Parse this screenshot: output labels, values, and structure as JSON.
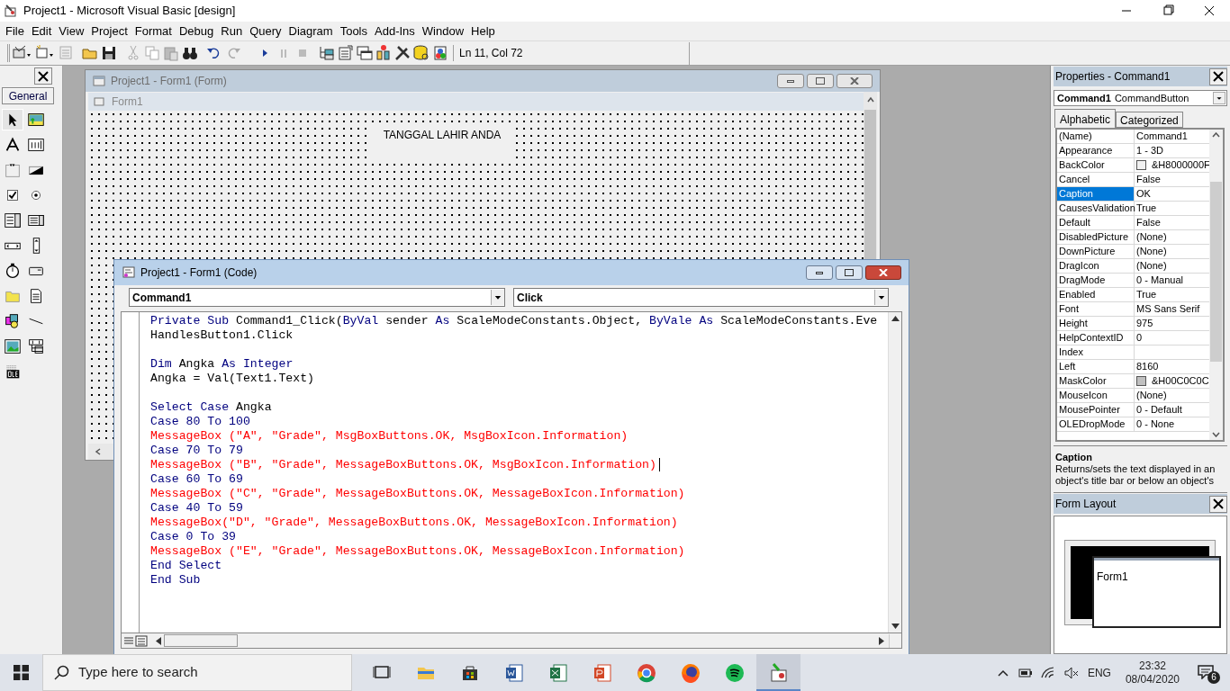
{
  "window": {
    "title": "Project1 - Microsoft Visual Basic [design]"
  },
  "menu": [
    "File",
    "Edit",
    "View",
    "Project",
    "Format",
    "Debug",
    "Run",
    "Query",
    "Diagram",
    "Tools",
    "Add-Ins",
    "Window",
    "Help"
  ],
  "toolbar": {
    "position": "Ln 11, Col 72"
  },
  "toolbox": {
    "tab": "General",
    "tools": [
      {
        "selected": true
      },
      {
        "selected": false
      },
      {
        "selected": false
      },
      {
        "selected": false
      },
      {
        "selected": false
      },
      {
        "selected": false
      },
      {
        "selected": false
      },
      {
        "selected": false
      },
      {
        "selected": false
      },
      {
        "selected": false
      },
      {
        "selected": false
      },
      {
        "selected": false
      },
      {
        "selected": false
      },
      {
        "selected": false
      },
      {
        "selected": false
      },
      {
        "selected": false
      },
      {
        "selected": false
      },
      {
        "selected": false
      },
      {
        "selected": false
      },
      {
        "selected": false
      },
      {
        "selected": false
      }
    ]
  },
  "form_window": {
    "title": "Project1 - Form1 (Form)",
    "form_caption": "Form1",
    "label": "TANGGAL LAHIR ANDA"
  },
  "code_window": {
    "title": "Project1 - Form1 (Code)",
    "object": "Command1",
    "procedure": "Click",
    "lines": [
      {
        "kind": "code",
        "segments": [
          {
            "kind": "keyword",
            "text": "Private Sub"
          },
          {
            "kind": "text",
            "text": " Command1_Click("
          },
          {
            "kind": "keyword",
            "text": "ByVal"
          },
          {
            "kind": "text",
            "text": " sender "
          },
          {
            "kind": "keyword",
            "text": "As"
          },
          {
            "kind": "text",
            "text": " ScaleModeConstants.Object, "
          },
          {
            "kind": "keyword",
            "text": "ByVale As"
          },
          {
            "kind": "text",
            "text": " ScaleModeConstants.Eve"
          }
        ]
      },
      {
        "kind": "code",
        "segments": [
          {
            "kind": "text",
            "text": "HandlesButton1.Click"
          }
        ]
      },
      {
        "kind": "blank"
      },
      {
        "kind": "code",
        "segments": [
          {
            "kind": "keyword",
            "text": "Dim"
          },
          {
            "kind": "text",
            "text": " Angka "
          },
          {
            "kind": "keyword",
            "text": "As Integer"
          }
        ]
      },
      {
        "kind": "code",
        "segments": [
          {
            "kind": "text",
            "text": "Angka = Val(Text1.Text)"
          }
        ]
      },
      {
        "kind": "blank"
      },
      {
        "kind": "code",
        "segments": [
          {
            "kind": "keyword",
            "text": "Select Case"
          },
          {
            "kind": "text",
            "text": " Angka"
          }
        ]
      },
      {
        "kind": "code",
        "segments": [
          {
            "kind": "keyword",
            "text": "Case 80 To 100"
          }
        ]
      },
      {
        "kind": "error",
        "text": "MessageBox (\"A\", \"Grade\", MsgBoxButtons.OK, MsgBoxIcon.Information)",
        "cursor": false
      },
      {
        "kind": "code",
        "segments": [
          {
            "kind": "keyword",
            "text": "Case 70 To 79"
          }
        ]
      },
      {
        "kind": "error",
        "text": "MessageBox (\"B\", \"Grade\", MessageBoxButtons.OK, MsgBoxIcon.Information)",
        "cursor": true
      },
      {
        "kind": "code",
        "segments": [
          {
            "kind": "keyword",
            "text": "Case 60 To 69"
          }
        ]
      },
      {
        "kind": "error",
        "text": "MessageBox (\"C\", \"Grade\", MessageBoxButtons.OK, MessageBoxIcon.Information)",
        "cursor": false
      },
      {
        "kind": "code",
        "segments": [
          {
            "kind": "keyword",
            "text": "Case 40 To 59"
          }
        ]
      },
      {
        "kind": "error",
        "text": "MessageBox(\"D\", \"Grade\", MessageBoxButtons.OK, MessageBoxIcon.Information)",
        "cursor": false
      },
      {
        "kind": "code",
        "segments": [
          {
            "kind": "keyword",
            "text": "Case 0 To 39"
          }
        ]
      },
      {
        "kind": "error",
        "text": "MessageBox (\"E\", \"Grade\", MessageBoxButtons.OK, MessageBoxIcon.Information)",
        "cursor": false
      },
      {
        "kind": "code",
        "segments": [
          {
            "kind": "keyword",
            "text": "End Select"
          }
        ]
      },
      {
        "kind": "code",
        "segments": [
          {
            "kind": "keyword",
            "text": "End Sub"
          }
        ]
      }
    ]
  },
  "properties": {
    "title": "Properties - Command1",
    "object": "Command1",
    "object_type": "CommandButton",
    "tabs": [
      {
        "label": "Alphabetic",
        "selected": true
      },
      {
        "label": "Categorized",
        "selected": false
      }
    ],
    "rows": [
      {
        "name": "(Name)",
        "value": "Command1",
        "selected": false
      },
      {
        "name": "Appearance",
        "value": "1 - 3D",
        "selected": false
      },
      {
        "name": "BackColor",
        "value": "&H8000000F",
        "selected": false,
        "color": "#f0f0f0"
      },
      {
        "name": "Cancel",
        "value": "False",
        "selected": false
      },
      {
        "name": "Caption",
        "value": "OK",
        "selected": true
      },
      {
        "name": "CausesValidation",
        "value": "True",
        "selected": false
      },
      {
        "name": "Default",
        "value": "False",
        "selected": false
      },
      {
        "name": "DisabledPicture",
        "value": "(None)",
        "selected": false
      },
      {
        "name": "DownPicture",
        "value": "(None)",
        "selected": false
      },
      {
        "name": "DragIcon",
        "value": "(None)",
        "selected": false
      },
      {
        "name": "DragMode",
        "value": "0 - Manual",
        "selected": false
      },
      {
        "name": "Enabled",
        "value": "True",
        "selected": false
      },
      {
        "name": "Font",
        "value": "MS Sans Serif",
        "selected": false
      },
      {
        "name": "Height",
        "value": "975",
        "selected": false
      },
      {
        "name": "HelpContextID",
        "value": "0",
        "selected": false
      },
      {
        "name": "Index",
        "selected": false
      },
      {
        "name": "Left",
        "value": "8160",
        "selected": false
      },
      {
        "name": "MaskColor",
        "value": "&H00C0C0C",
        "selected": false,
        "color": "#c0c0c0"
      },
      {
        "name": "MouseIcon",
        "value": "(None)",
        "selected": false
      },
      {
        "name": "MousePointer",
        "value": "0 - Default",
        "selected": false
      },
      {
        "name": "OLEDropMode",
        "value": "0 - None",
        "selected": false
      }
    ],
    "description": {
      "title": "Caption",
      "text": "Returns/sets the text displayed in an object's title bar or below an object's"
    }
  },
  "form_layout": {
    "title": "Form Layout",
    "form": "Form1"
  },
  "taskbar": {
    "search_placeholder": "Type here to search",
    "language": "ENG",
    "time": "23:32",
    "date": "08/04/2020",
    "notifications": "6"
  }
}
